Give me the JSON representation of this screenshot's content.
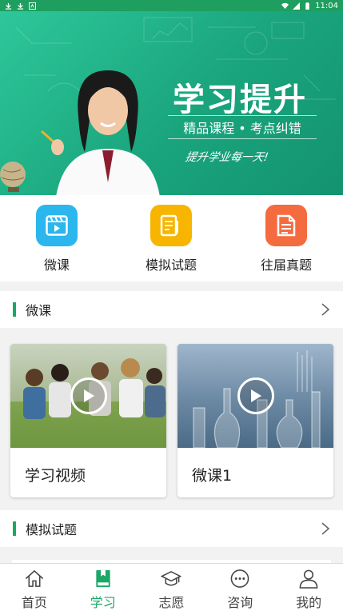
{
  "status_bar": {
    "time": "11:04"
  },
  "banner": {
    "title": "学习提升",
    "subtitle": "精品课程 • 考点纠错",
    "slogan": "提升学业每一天!"
  },
  "quick": [
    {
      "label": "微课",
      "icon": "video-icon",
      "color": "#2bb6ee"
    },
    {
      "label": "模拟试题",
      "icon": "exam-pencil-icon",
      "color": "#f7b500"
    },
    {
      "label": "往届真题",
      "icon": "document-icon",
      "color": "#f46b3f"
    }
  ],
  "sections": {
    "micro": {
      "title": "微课"
    },
    "mock": {
      "title": "模拟试题"
    }
  },
  "cards": [
    {
      "title": "学习视频"
    },
    {
      "title": "微课1"
    }
  ],
  "tabs": [
    {
      "label": "首页",
      "icon": "home-icon"
    },
    {
      "label": "学习",
      "icon": "book-icon",
      "active": true
    },
    {
      "label": "志愿",
      "icon": "graduation-cap-icon"
    },
    {
      "label": "咨询",
      "icon": "chat-icon"
    },
    {
      "label": "我的",
      "icon": "user-icon"
    }
  ],
  "colors": {
    "accent": "#1aa867",
    "status_bar": "#1e9f5f"
  }
}
